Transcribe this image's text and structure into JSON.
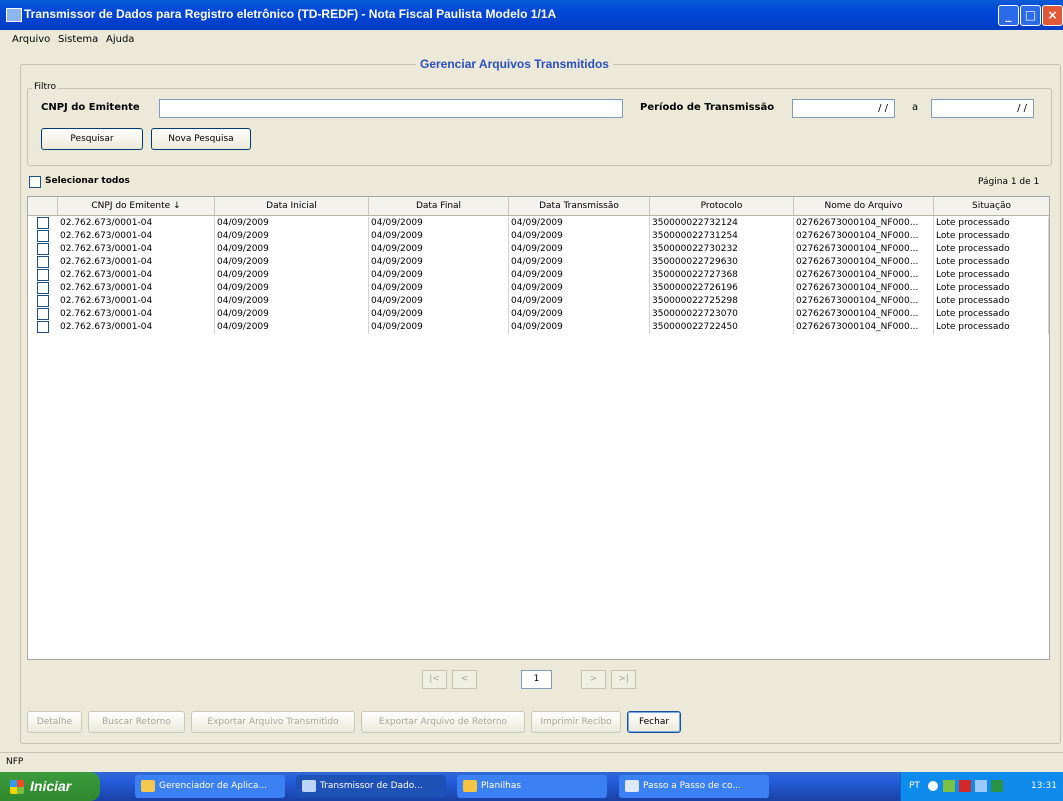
{
  "window": {
    "title": "Transmissor de Dados para Registro eletrônico (TD-REDF) - Nota Fiscal Paulista Modelo 1/1A"
  },
  "menu": [
    "Arquivo",
    "Sistema",
    "Ajuda"
  ],
  "page": {
    "heading": "Gerenciar Arquivos Transmitidos"
  },
  "filter": {
    "legend": "Filtro",
    "cnpj_label": "CNPJ do Emitente",
    "cnpj_value": "",
    "periodo_label": "Período de Transmissão",
    "date_from": "/ /",
    "date_sep": "a",
    "date_to": "/ /",
    "pesquisar": "Pesquisar",
    "nova_pesquisa": "Nova Pesquisa"
  },
  "select_all": "Selecionar todos",
  "page_info": "Página 1 de 1",
  "table": {
    "columns": [
      "CNPJ do Emitente ↓",
      "Data Inicial",
      "Data Final",
      "Data Transmissão",
      "Protocolo",
      "Nome do Arquivo",
      "Situação"
    ],
    "rows": [
      [
        "02.762.673/0001-04",
        "04/09/2009",
        "04/09/2009",
        "04/09/2009",
        "350000022732124",
        "02762673000104_NF000...",
        "Lote processado"
      ],
      [
        "02.762.673/0001-04",
        "04/09/2009",
        "04/09/2009",
        "04/09/2009",
        "350000022731254",
        "02762673000104_NF000...",
        "Lote processado"
      ],
      [
        "02.762.673/0001-04",
        "04/09/2009",
        "04/09/2009",
        "04/09/2009",
        "350000022730232",
        "02762673000104_NF000...",
        "Lote processado"
      ],
      [
        "02.762.673/0001-04",
        "04/09/2009",
        "04/09/2009",
        "04/09/2009",
        "350000022729630",
        "02762673000104_NF000...",
        "Lote processado"
      ],
      [
        "02.762.673/0001-04",
        "04/09/2009",
        "04/09/2009",
        "04/09/2009",
        "350000022727368",
        "02762673000104_NF000...",
        "Lote processado"
      ],
      [
        "02.762.673/0001-04",
        "04/09/2009",
        "04/09/2009",
        "04/09/2009",
        "350000022726196",
        "02762673000104_NF000...",
        "Lote processado"
      ],
      [
        "02.762.673/0001-04",
        "04/09/2009",
        "04/09/2009",
        "04/09/2009",
        "350000022725298",
        "02762673000104_NF000...",
        "Lote processado"
      ],
      [
        "02.762.673/0001-04",
        "04/09/2009",
        "04/09/2009",
        "04/09/2009",
        "350000022723070",
        "02762673000104_NF000...",
        "Lote processado"
      ],
      [
        "02.762.673/0001-04",
        "04/09/2009",
        "04/09/2009",
        "04/09/2009",
        "350000022722450",
        "02762673000104_NF000...",
        "Lote processado"
      ]
    ]
  },
  "pager": {
    "first": "|<",
    "prev": "<",
    "current": "1",
    "next": ">",
    "last": ">|"
  },
  "actions": {
    "detalhe": "Detalhe",
    "buscar_retorno": "Buscar Retorno",
    "exportar_transmitido": "Exportar Arquivo Transmitido",
    "exportar_retorno": "Exportar Arquivo de Retorno",
    "imprimir_recibo": "Imprimir Recibo",
    "fechar": "Fechar"
  },
  "status": "NFP",
  "taskbar": {
    "start": "Iniciar",
    "items": [
      "Gerenciador de Aplica...",
      "Transmissor de Dado...",
      "Planilhas",
      "Passo a Passo de co..."
    ],
    "tray_lang": "PT",
    "clock": "13:31"
  },
  "colors": {
    "heading": "#2a4fbf",
    "titlebar": "#0046d5",
    "taskbar": "#245edb",
    "start": "#2f8a2f"
  }
}
